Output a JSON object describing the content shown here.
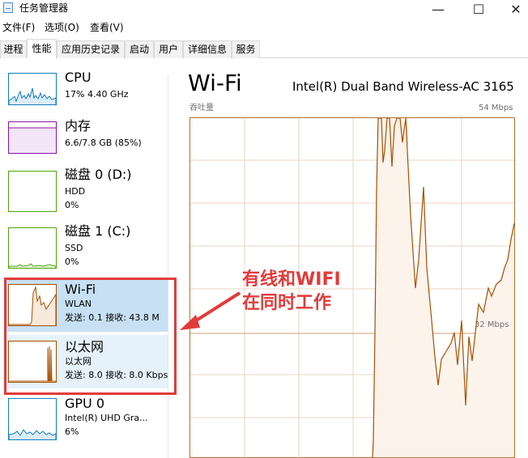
{
  "window": {
    "title": "任务管理器",
    "controls": {
      "minimize": "—",
      "maximize": "☐",
      "close": "✕"
    }
  },
  "menu": [
    "文件(F)",
    "选项(O)",
    "查看(V)"
  ],
  "tabs": [
    "进程",
    "性能",
    "应用历史记录",
    "启动",
    "用户",
    "详细信息",
    "服务"
  ],
  "active_tab": "性能",
  "sidebar": {
    "items": [
      {
        "name": "CPU",
        "line1": "17%  4.40 GHz",
        "line2": "",
        "color": "#117dbb"
      },
      {
        "name": "内存",
        "line1": "6.6/7.8 GB (85%)",
        "line2": "",
        "color": "#8b12ae"
      },
      {
        "name": "磁盘 0 (D:)",
        "line1": "HDD",
        "line2": "0%",
        "color": "#4da60c"
      },
      {
        "name": "磁盘 1 (C:)",
        "line1": "SSD",
        "line2": "0%",
        "color": "#4da60c"
      },
      {
        "name": "Wi-Fi",
        "line1": "WLAN",
        "line2": "发送: 0.1  接收: 43.8 M",
        "color": "#a74f01"
      },
      {
        "name": "以太网",
        "line1": "以太网",
        "line2": "发送: 8.0  接收: 8.0 Kbps",
        "color": "#a74f01"
      },
      {
        "name": "GPU 0",
        "line1": "Intel(R) UHD Gra...",
        "line2": "6%",
        "color": "#117dbb"
      }
    ]
  },
  "main": {
    "title": "Wi-Fi",
    "adapter": "Intel(R) Dual Band Wireless-AC 3165",
    "throughput_label": "吞吐量",
    "max_label": "54 Mbps",
    "mid_label": "32 Mbps"
  },
  "annotation": {
    "line1": "有线和WIFI",
    "line2": "在同时工作",
    "color": "#e23b3b"
  },
  "colors": {
    "accent": "#a74f01",
    "graph_fill": "#fcf3eb",
    "grid": "#d9b792"
  }
}
